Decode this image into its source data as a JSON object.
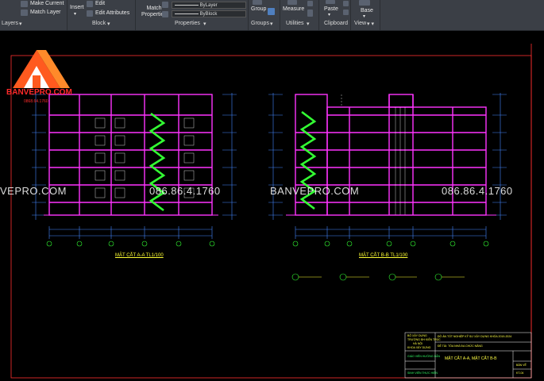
{
  "ribbon": {
    "make_current": "Make Current",
    "match_layer": "Match Layer",
    "insert": "Insert",
    "edit": "Edit",
    "edit_attributes": "Edit Attributes",
    "match_properties": "Match Properties",
    "by_layer": "ByLayer",
    "by_block": "ByBlock",
    "group": "Group",
    "measure": "Measure",
    "paste": "Paste",
    "base": "Base",
    "panels": {
      "layers": "Layers",
      "block": "Block",
      "properties": "Properties",
      "groups": "Groups",
      "utilities": "Utilities",
      "clipboard": "Clipboard",
      "view": "View"
    }
  },
  "brand": {
    "name": "BANVEPRO.COM",
    "phone": "0868.64.1760"
  },
  "watermarks": {
    "site_left": "VEPRO.COM",
    "phone_left": "086.86.4.1760",
    "site_right": "BANVEPRO.COM",
    "phone_right": "086.86.4.1760"
  },
  "drawings": {
    "section_aa": "MẶT CẮT A-A TL1/100",
    "section_bb": "MẶT CẮT B-B TL1/100"
  },
  "title_block": {
    "ministry": "BỘ XÂY DỰNG",
    "university": "TRƯỜNG ĐH KIẾN TRÚC",
    "city": "HÀ NỘI",
    "faculty": "KHOA XÂY DỰNG",
    "project": "ĐỒ ÁN TỐT NGHIỆP KỸ SƯ XÂY DỰNG KHÓA 2019-2024",
    "topic": "ĐỀ TÀI: TÒA NHÀ ĐA CHỨC NĂNG",
    "instructor_role": "GIÁO VIÊN HƯỚNG DẪN",
    "student_role": "SINH VIÊN THỰC HIỆN",
    "sheet_title": "MẶT CẮT A-A, MẶT CẮT B-B",
    "sheet_label": "BẢN VẼ",
    "sheet_number": "KT-04"
  },
  "colors": {
    "ribbon_bg": "#3b3f46",
    "canvas_bg": "#000000",
    "frame": "#ff3030",
    "structure": "#ff33ff",
    "stairs": "#33ff33",
    "text": "#ffff33",
    "brand": "#ff2a2a"
  }
}
